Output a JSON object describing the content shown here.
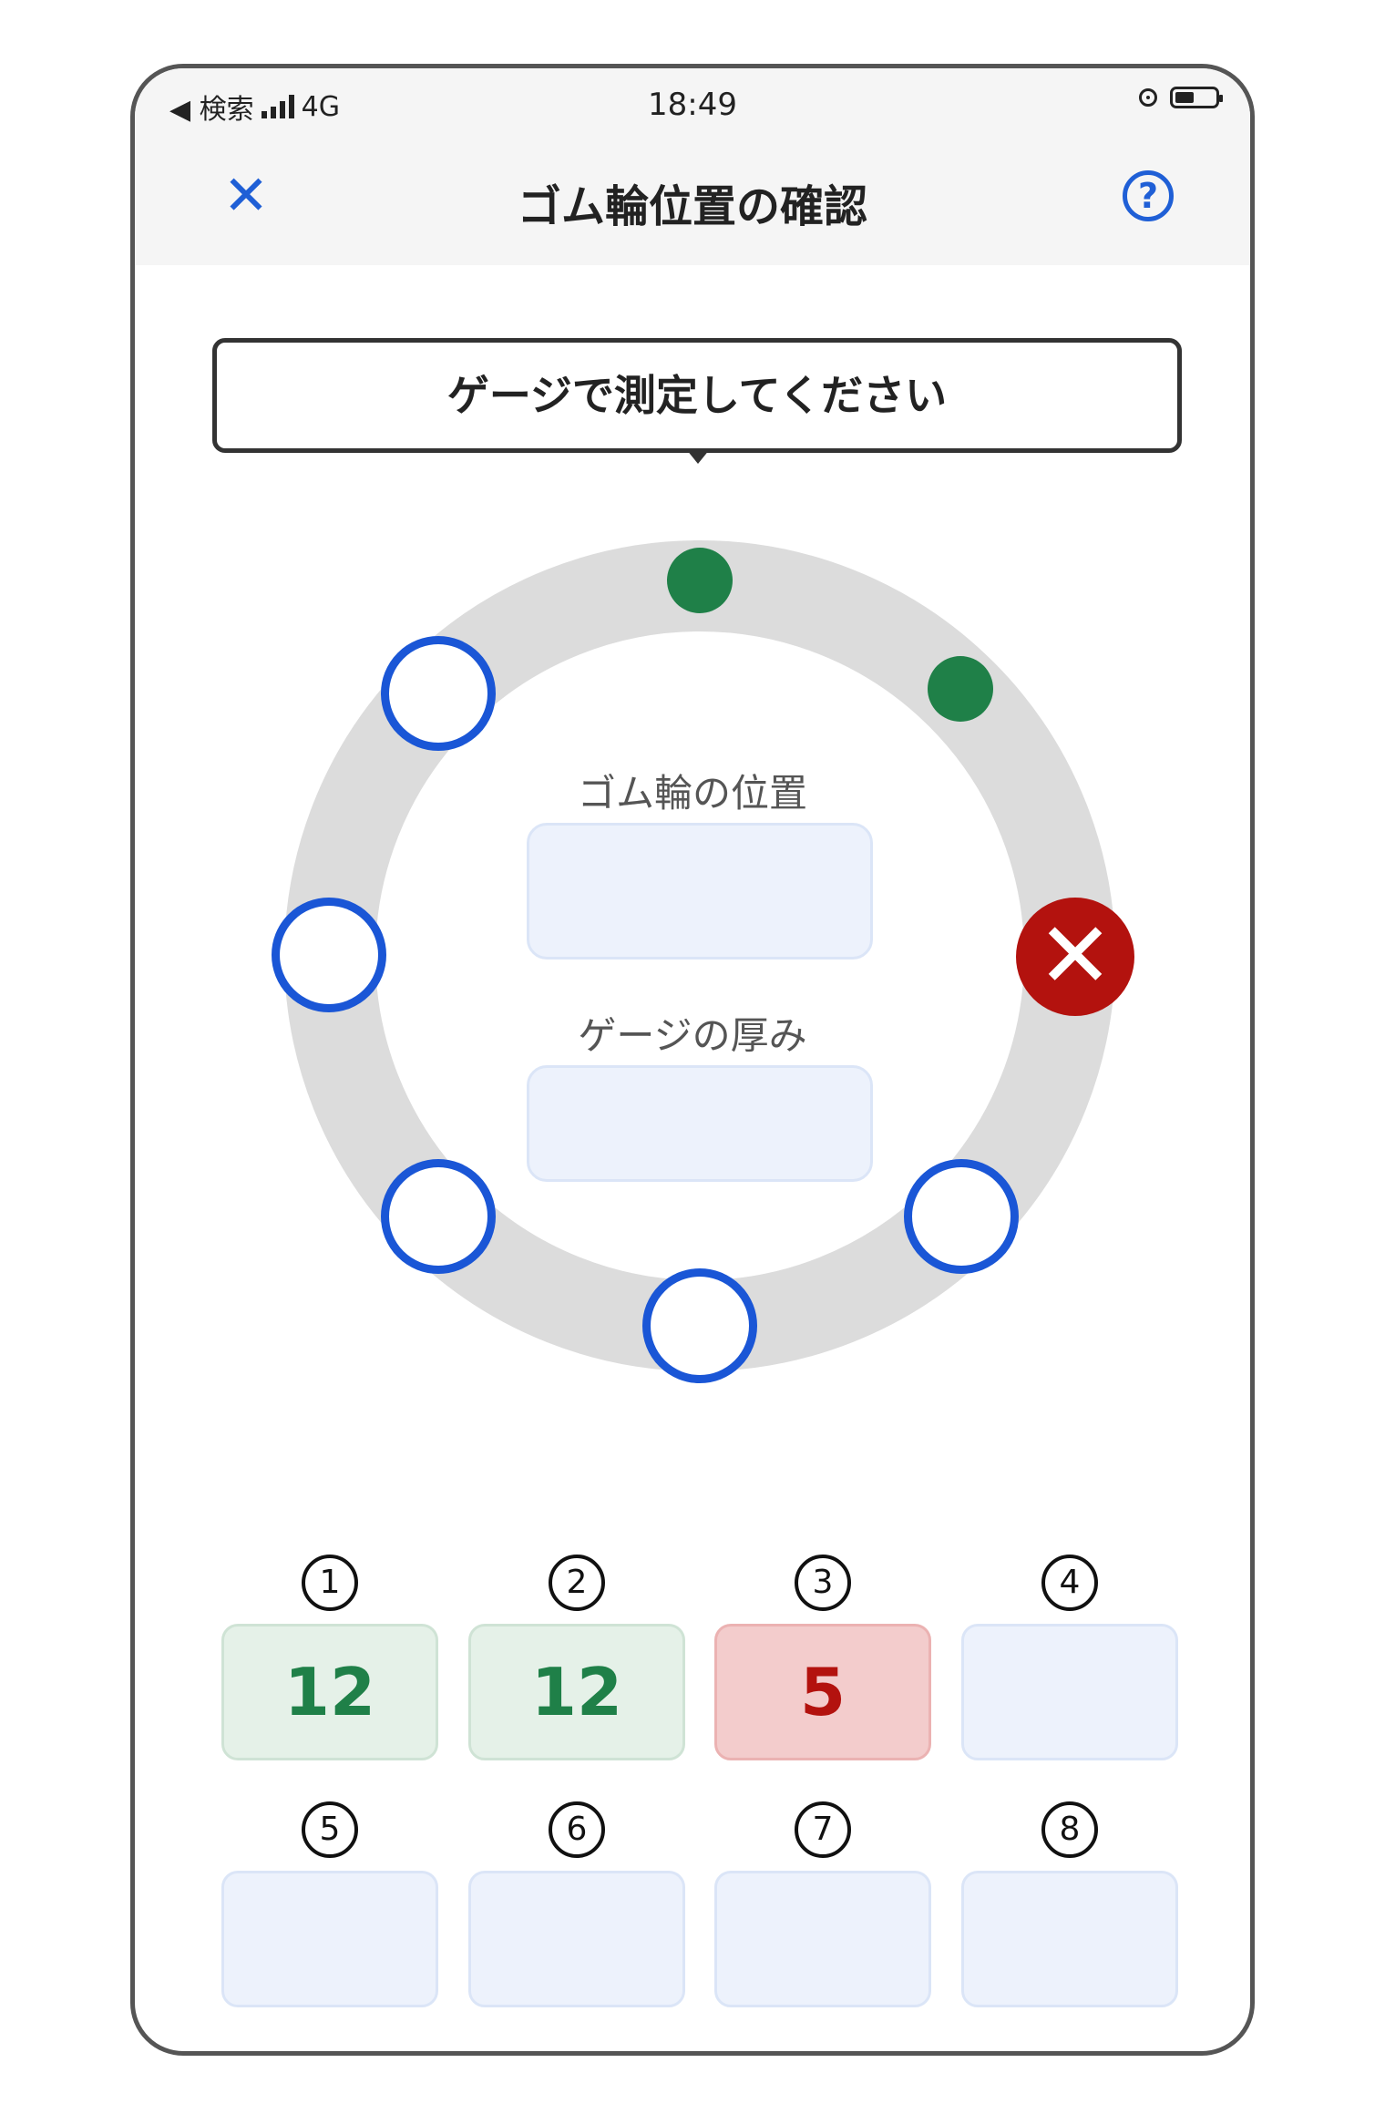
{
  "status_bar": {
    "back_app": "◀ 検索",
    "network": "4G",
    "time": "18:49"
  },
  "nav": {
    "close_icon": "✕",
    "title": "ゴム輪位置の確認",
    "help_icon": "?"
  },
  "instruction": "ゲージで測定してください",
  "center": {
    "position_label": "ゴム輪の位置",
    "position_value": "",
    "thickness_label": "ゲージの厚み",
    "thickness_value": ""
  },
  "ring_points": [
    {
      "state": "measured-ok"
    },
    {
      "state": "measured-ok"
    },
    {
      "state": "measured-ng",
      "icon": "✕"
    },
    {
      "state": "unmeasured"
    },
    {
      "state": "unmeasured"
    },
    {
      "state": "unmeasured"
    },
    {
      "state": "unmeasured"
    },
    {
      "state": "unmeasured"
    }
  ],
  "slots": [
    {
      "num": "1",
      "value": "12",
      "state": "ok"
    },
    {
      "num": "2",
      "value": "12",
      "state": "ok"
    },
    {
      "num": "3",
      "value": "5",
      "state": "bad"
    },
    {
      "num": "4",
      "value": "",
      "state": "empty"
    },
    {
      "num": "5",
      "value": "",
      "state": "empty"
    },
    {
      "num": "6",
      "value": "",
      "state": "empty"
    },
    {
      "num": "7",
      "value": "",
      "state": "empty"
    },
    {
      "num": "8",
      "value": "",
      "state": "empty"
    }
  ],
  "colors": {
    "accent_blue": "#1a56d6",
    "ok_green": "#1f8048",
    "ng_red": "#b3120e",
    "ring_gray": "#dcdcdc"
  }
}
